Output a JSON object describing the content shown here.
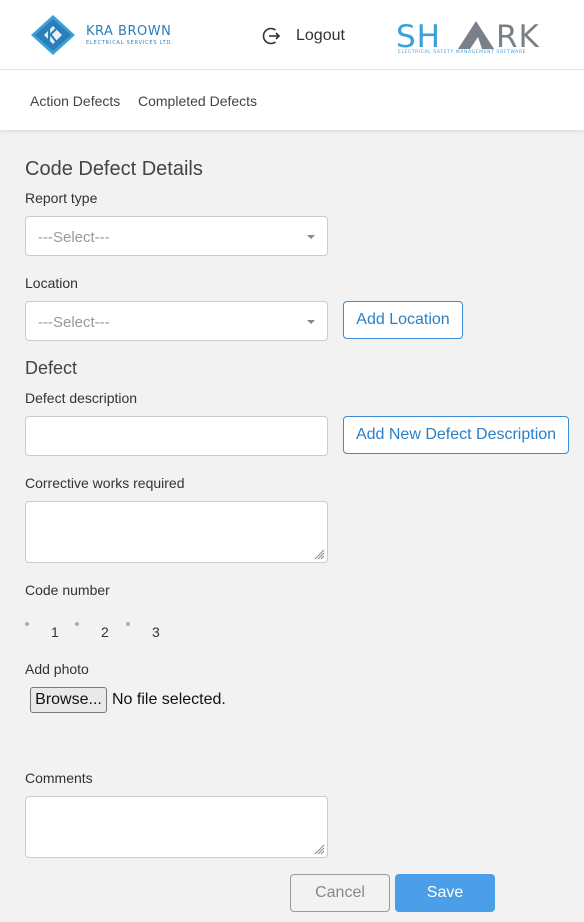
{
  "header": {
    "company_logo": {
      "name": "KRA BROWN",
      "tagline": "ELECTRICAL SERVICES LTD."
    },
    "logout_label": "Logout",
    "app_logo": {
      "text": "SHARK",
      "tagline": "ELECTRICAL SAFETY MANAGEMENT SOFTWARE"
    }
  },
  "nav": {
    "items": [
      {
        "label": "Action Defects"
      },
      {
        "label": "Completed Defects"
      }
    ]
  },
  "form": {
    "title": "Code Defect Details",
    "report_type": {
      "label": "Report type",
      "value": "---Select---"
    },
    "location": {
      "label": "Location",
      "value": "---Select---",
      "add_button": "Add Location"
    },
    "defect_heading": "Defect",
    "defect_description": {
      "label": "Defect description",
      "value": "",
      "add_button": "Add New Defect Description"
    },
    "corrective_works": {
      "label": "Corrective works required",
      "value": ""
    },
    "code_number": {
      "label": "Code number",
      "options": [
        "1",
        "2",
        "3"
      ]
    },
    "add_photo": {
      "label": "Add photo",
      "browse_label": "Browse...",
      "status": "No file selected."
    },
    "comments": {
      "label": "Comments",
      "value": ""
    },
    "cancel_label": "Cancel",
    "save_label": "Save"
  },
  "colors": {
    "accent": "#3a8dd6",
    "primary_button": "#4a9fe8",
    "page_background": "#f2f2f2",
    "logo_blue": "#2a7fb8",
    "shark_gray": "#7a8088"
  }
}
